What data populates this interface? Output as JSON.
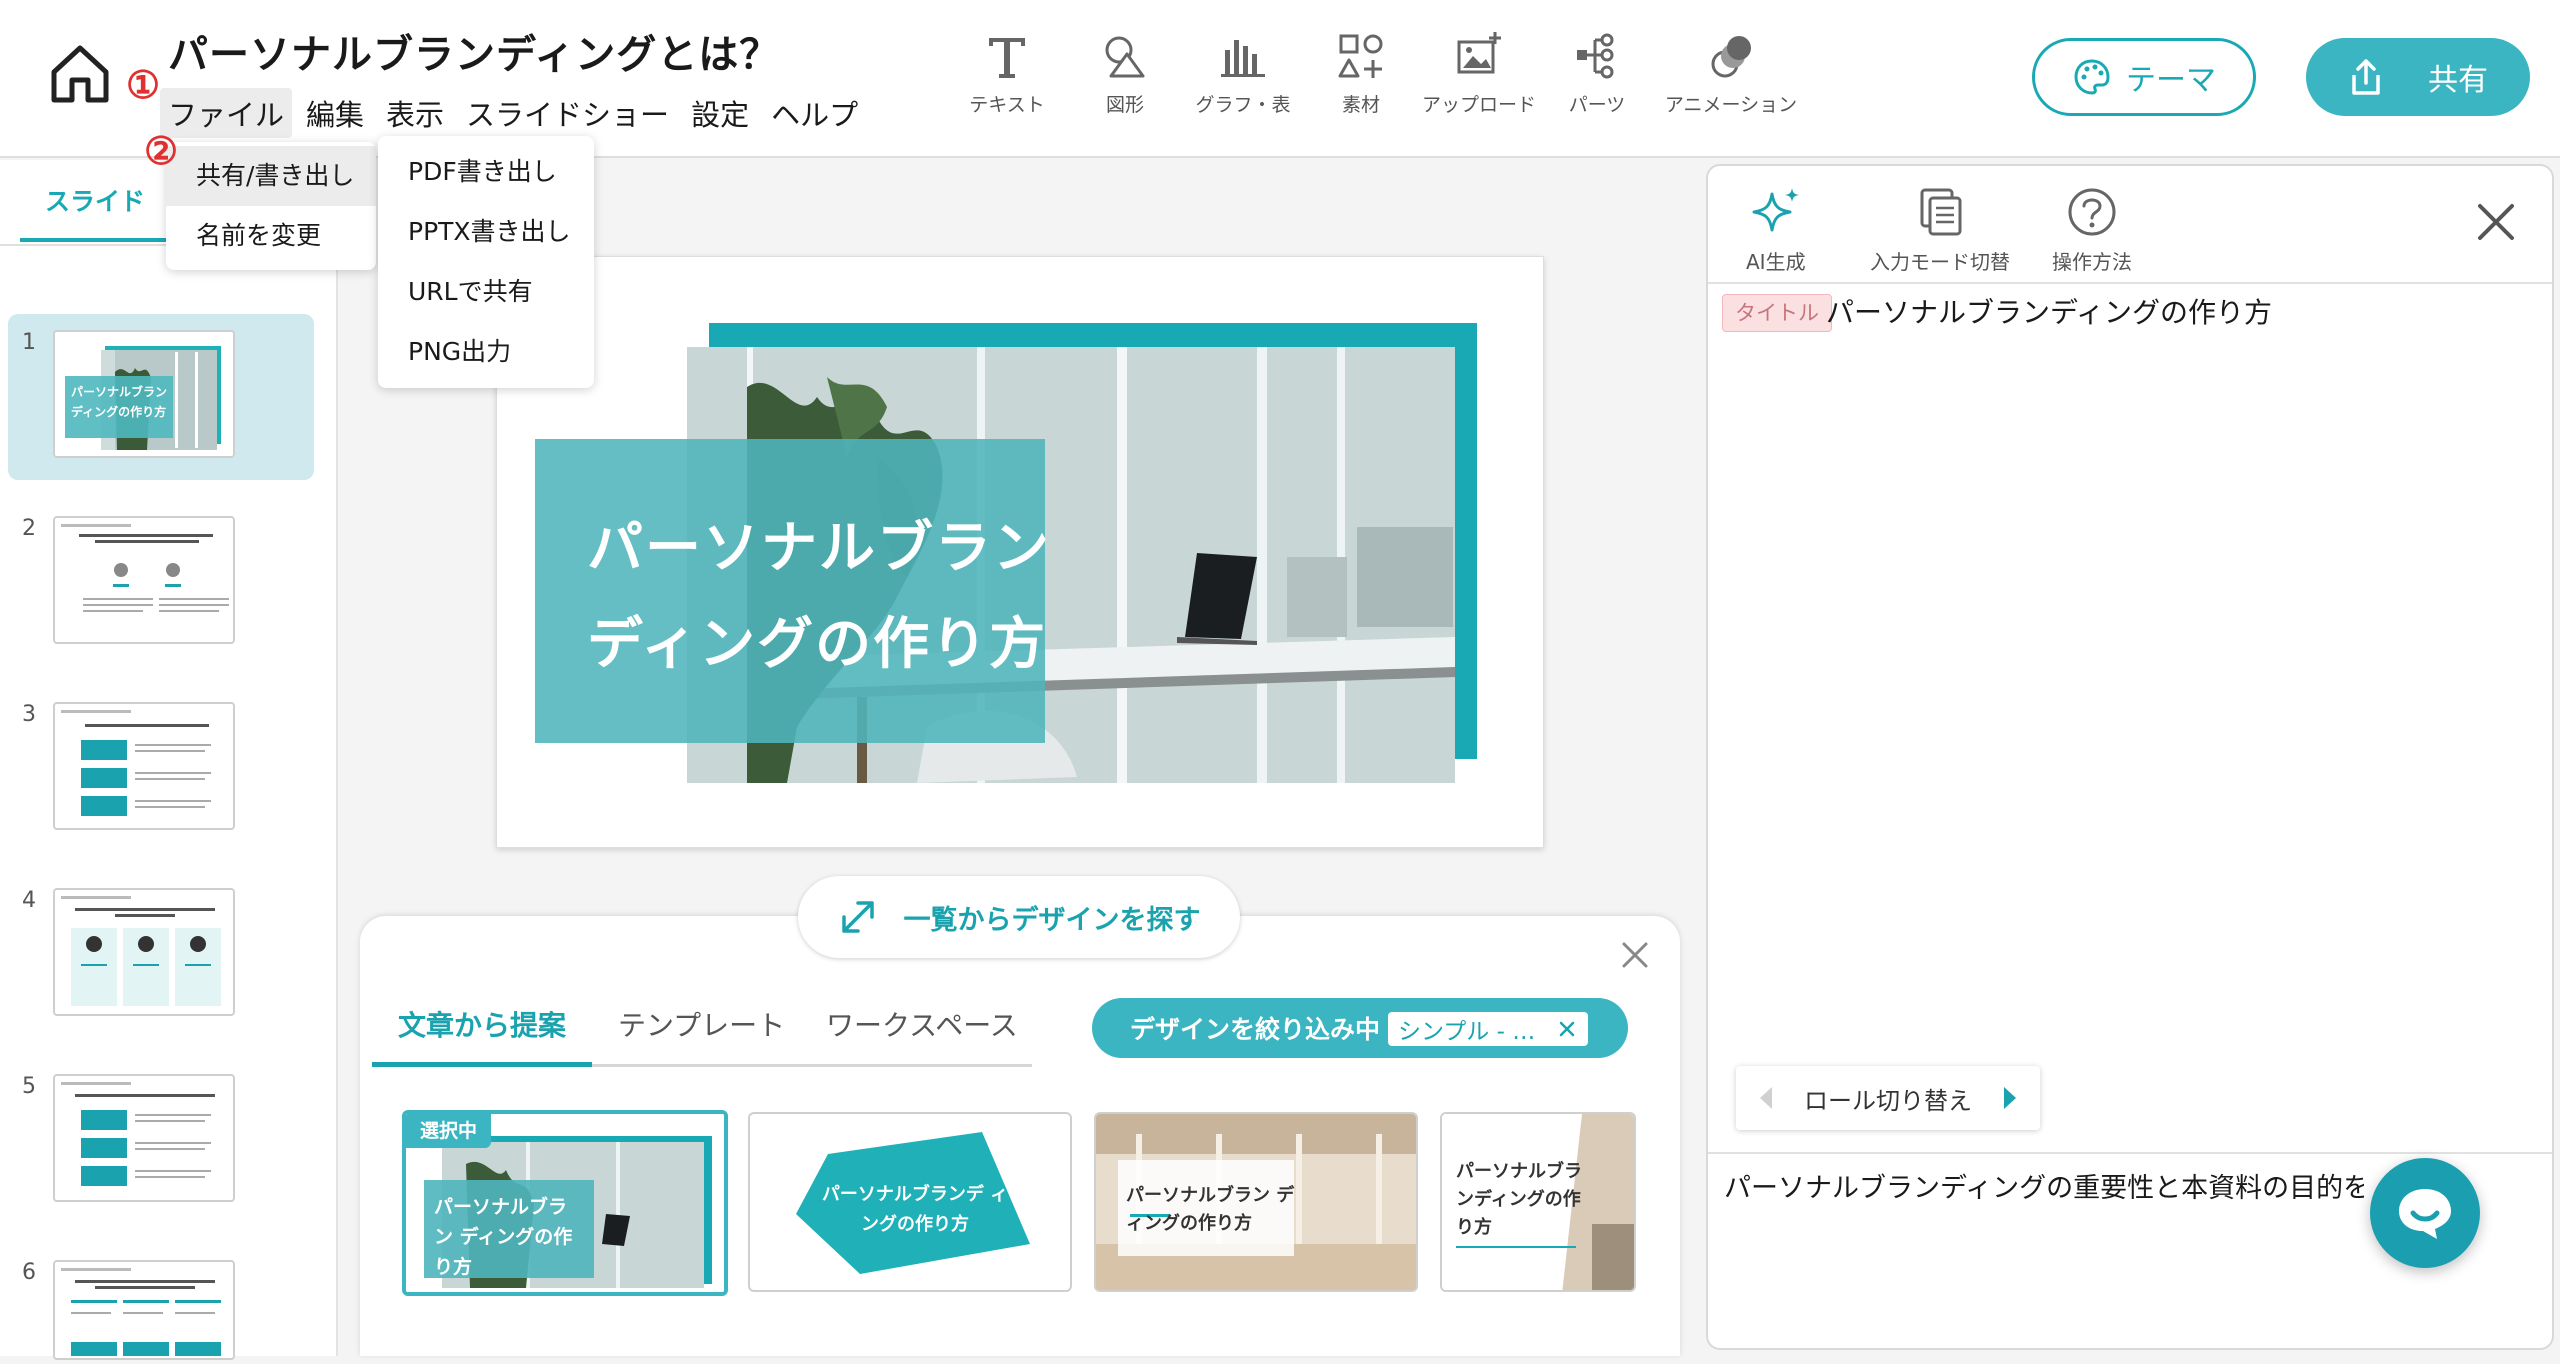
{
  "document": {
    "title": "パーソナルブランディングとは？"
  },
  "menubar": {
    "items": [
      "ファイル",
      "編集",
      "表示",
      "スライドショー",
      "設定",
      "ヘルプ"
    ]
  },
  "step_badges": [
    "①",
    "②"
  ],
  "toolbar": {
    "items": [
      {
        "label": "テキスト",
        "icon": "text-icon"
      },
      {
        "label": "図形",
        "icon": "shapes-icon"
      },
      {
        "label": "グラフ・表",
        "icon": "chart-icon"
      },
      {
        "label": "素材",
        "icon": "assets-icon"
      },
      {
        "label": "アップロード",
        "icon": "upload-image-icon"
      },
      {
        "label": "パーツ",
        "icon": "parts-icon"
      },
      {
        "label": "アニメーション",
        "icon": "animation-icon"
      }
    ],
    "theme_label": "テーマ",
    "share_label": "共有"
  },
  "file_menu": {
    "items": [
      "共有/書き出し",
      "名前を変更"
    ]
  },
  "export_menu": {
    "items": [
      "PDF書き出し",
      "PPTX書き出し",
      "URLで共有",
      "PNG出力"
    ]
  },
  "left_panel": {
    "tab_label": "スライド",
    "slides": [
      {
        "num": "1",
        "title": "パーソナルブラン ディングの作り方"
      },
      {
        "num": "2"
      },
      {
        "num": "3"
      },
      {
        "num": "4"
      },
      {
        "num": "5"
      },
      {
        "num": "6"
      }
    ]
  },
  "slide": {
    "title_line1": "パーソナルブラン",
    "title_line2": "ディングの作り方"
  },
  "design_panel": {
    "browse_label": "一覧からデザインを探す",
    "tabs": [
      "文章から提案",
      "テンプレート",
      "ワークスペース"
    ],
    "filter_label": "デザインを絞り込み中",
    "filter_chip": "シンプル - …",
    "selected_badge": "選択中",
    "cards": [
      {
        "text": "パーソナルブラン ディングの作り方"
      },
      {
        "text": "パーソナルブランデ ィングの作り方"
      },
      {
        "text": "パーソナルブラン ディングの作り方"
      },
      {
        "text": "パーソナルブラ ンディングの作 り方"
      }
    ]
  },
  "right_panel": {
    "tools": [
      {
        "label": "AI生成",
        "icon": "sparkle-icon"
      },
      {
        "label": "入力モード切替",
        "icon": "copy-icon"
      },
      {
        "label": "操作方法",
        "icon": "help-icon"
      }
    ],
    "title_tag": "タイトル",
    "title_text": "パーソナルブランディングの作り方",
    "role_toggle_label": "ロール切り替え",
    "body_text": "パーソナルブランディングの重要性と本資料の目的を紹"
  },
  "colors": {
    "accent": "#18a9b4",
    "accent_light": "#3bb5c1",
    "step_red": "#e03030"
  }
}
